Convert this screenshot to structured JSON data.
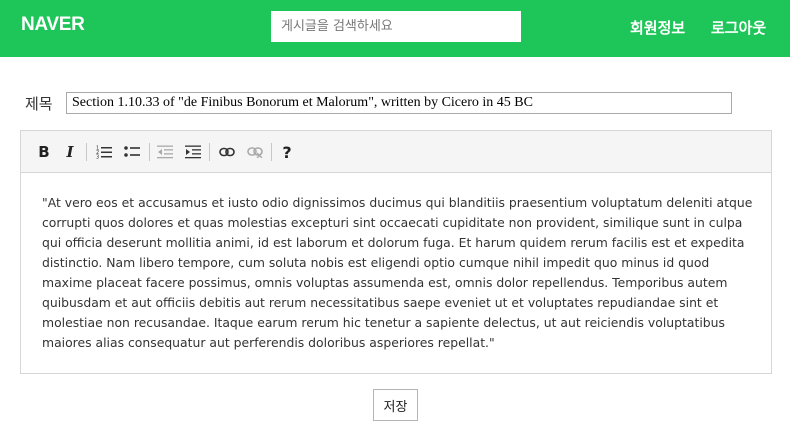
{
  "header": {
    "logo": "NAVER",
    "search_placeholder": "게시글을 검색하세요",
    "nav": {
      "member_info": "회원정보",
      "logout": "로그아웃"
    },
    "brand_color": "#1ec659"
  },
  "form": {
    "title_label": "제목",
    "title_value": "Section 1.10.33 of \"de Finibus Bonorum et Malorum\", written by Cicero in 45 BC"
  },
  "toolbar": {
    "buttons": [
      {
        "name": "bold",
        "label": "B",
        "icon": "bold-icon"
      },
      {
        "name": "italic",
        "label": "I",
        "icon": "italic-icon"
      },
      {
        "name": "numbered-list",
        "icon": "numbered-list-icon"
      },
      {
        "name": "bulleted-list",
        "icon": "bulleted-list-icon"
      },
      {
        "name": "outdent",
        "icon": "outdent-icon",
        "disabled": true
      },
      {
        "name": "indent",
        "icon": "indent-icon"
      },
      {
        "name": "link",
        "icon": "link-icon"
      },
      {
        "name": "unlink",
        "icon": "unlink-icon",
        "disabled": true
      },
      {
        "name": "help",
        "label": "?",
        "icon": "help-icon"
      }
    ]
  },
  "editor": {
    "content": "\"At vero eos et accusamus et iusto odio dignissimos ducimus qui blanditiis praesentium voluptatum deleniti atque corrupti quos dolores et quas molestias excepturi sint occaecati cupiditate non provident, similique sunt in culpa qui officia deserunt mollitia animi, id est laborum et dolorum fuga. Et harum quidem rerum facilis est et expedita distinctio. Nam libero tempore, cum soluta nobis est eligendi optio cumque nihil impedit quo minus id quod maxime placeat facere possimus, omnis voluptas assumenda est, omnis dolor repellendus. Temporibus autem quibusdam et aut officiis debitis aut rerum necessitatibus saepe eveniet ut et voluptates repudiandae sint et molestiae non recusandae. Itaque earum rerum hic tenetur a sapiente delectus, ut aut reiciendis voluptatibus maiores alias consequatur aut perferendis doloribus asperiores repellat.\""
  },
  "actions": {
    "save_label": "저장"
  }
}
